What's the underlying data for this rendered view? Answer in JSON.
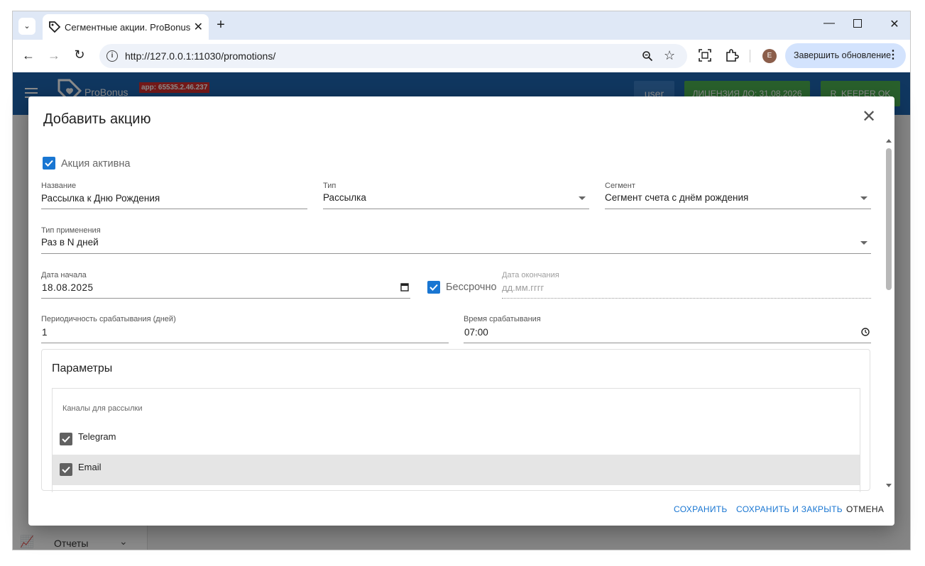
{
  "browser": {
    "tab_title": "Сегментные акции. ProBonus",
    "url": "http://127.0.0.1:11030/promotions/",
    "update_button": "Завершить обновление",
    "avatar_letter": "E"
  },
  "app": {
    "logo_text": "ProBonus",
    "version_badge": "app: 65535.2.46.237",
    "user_button": "user",
    "license_button": "ЛИЦЕНЗИЯ ДО: 31.08.2026",
    "keeper_button": "R_KEEPER OK",
    "sidebar_reports": "Отчеты"
  },
  "dialog": {
    "title": "Добавить акцию",
    "active_label": "Акция активна",
    "active_checked": true,
    "name": {
      "label": "Название",
      "value": "Рассылка к Дню Рождения"
    },
    "type": {
      "label": "Тип",
      "value": "Рассылка"
    },
    "segment": {
      "label": "Сегмент",
      "value": "Сегмент счета с днём рождения"
    },
    "apply_type": {
      "label": "Тип применения",
      "value": "Раз в N дней"
    },
    "start_date": {
      "label": "Дата начала",
      "value": "18.08.2025"
    },
    "unlimited": {
      "label": "Бессрочно",
      "checked": true
    },
    "end_date": {
      "label": "Дата окончания",
      "placeholder": "дд.мм.гггг"
    },
    "period": {
      "label": "Периодичность срабатывания (дней)",
      "value": "1"
    },
    "time": {
      "label": "Время срабатывания",
      "value": "07:00"
    },
    "params": {
      "title": "Параметры",
      "channels_label": "Каналы для рассылки",
      "channels": [
        {
          "name": "Telegram",
          "checked": true
        },
        {
          "name": "Email",
          "checked": true
        }
      ]
    },
    "buttons": {
      "save": "СОХРАНИТЬ",
      "save_close": "СОХРАНИТЬ И ЗАКРЫТЬ",
      "cancel": "ОТМЕНА"
    }
  },
  "colors": {
    "accent": "#1976d2",
    "appbar": "#1e64b0",
    "license_green": "#4caf50"
  }
}
